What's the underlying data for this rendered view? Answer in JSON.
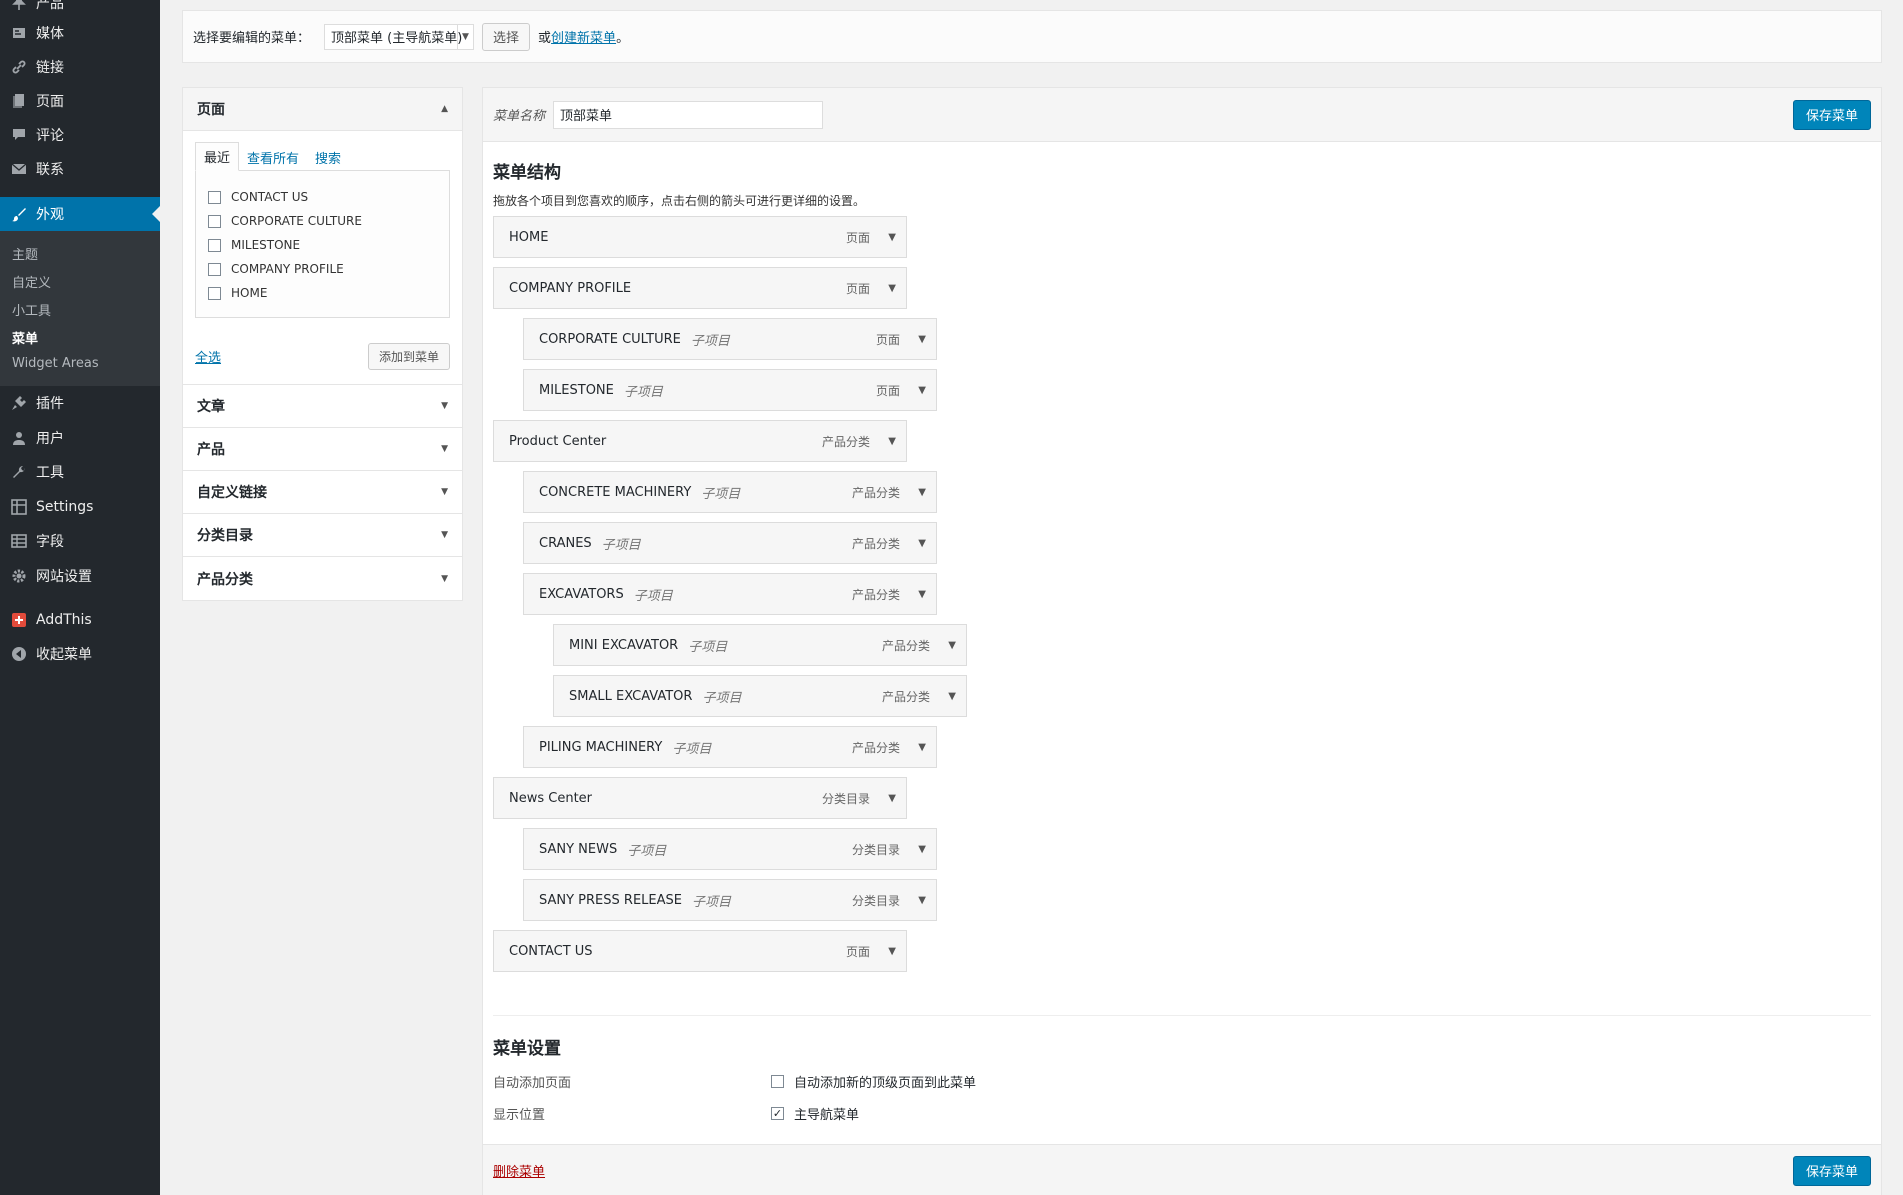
{
  "sidebar": {
    "items": [
      {
        "label": "产品",
        "icon": "pin-icon"
      },
      {
        "label": "媒体",
        "icon": "media-icon"
      },
      {
        "label": "链接",
        "icon": "link-icon"
      },
      {
        "label": "页面",
        "icon": "page-icon"
      },
      {
        "label": "评论",
        "icon": "comment-icon"
      },
      {
        "label": "联系",
        "icon": "mail-icon"
      },
      {
        "label": "外观",
        "icon": "brush-icon"
      },
      {
        "label": "插件",
        "icon": "plugin-icon"
      },
      {
        "label": "用户",
        "icon": "user-icon"
      },
      {
        "label": "工具",
        "icon": "wrench-icon"
      },
      {
        "label": "Settings",
        "icon": "settings-grid-icon"
      },
      {
        "label": "字段",
        "icon": "fields-icon"
      },
      {
        "label": "网站设置",
        "icon": "gear-icon"
      },
      {
        "label": "AddThis",
        "icon": "addthis-icon"
      },
      {
        "label": "收起菜单",
        "icon": "collapse-icon"
      }
    ],
    "submenu": [
      "主题",
      "自定义",
      "小工具",
      "菜单",
      "Widget Areas"
    ]
  },
  "topbar": {
    "label": "选择要编辑的菜单：",
    "selected": "顶部菜单 (主导航菜单)",
    "select_button": "选择",
    "or": "或",
    "create_link": "创建新菜单",
    "period": "。"
  },
  "left": {
    "pages_title": "页面",
    "tabs": [
      "最近",
      "查看所有",
      "搜索"
    ],
    "pages": [
      "CONTACT US",
      "CORPORATE CULTURE",
      "MILESTONE",
      "COMPANY PROFILE",
      "HOME"
    ],
    "select_all": "全选",
    "add_button": "添加到菜单",
    "sections": [
      "文章",
      "产品",
      "自定义链接",
      "分类目录",
      "产品分类"
    ]
  },
  "right": {
    "name_label": "菜单名称",
    "name_value": "顶部菜单",
    "save_button": "保存菜单",
    "structure_title": "菜单结构",
    "structure_desc": "拖放各个项目到您喜欢的顺序，点击右侧的箭头可进行更详细的设置。",
    "sub_label": "子项目",
    "items": [
      {
        "title": "HOME",
        "type": "页面",
        "depth": 0,
        "sub": false
      },
      {
        "title": "COMPANY PROFILE",
        "type": "页面",
        "depth": 0,
        "sub": false
      },
      {
        "title": "CORPORATE CULTURE",
        "type": "页面",
        "depth": 1,
        "sub": true
      },
      {
        "title": "MILESTONE",
        "type": "页面",
        "depth": 1,
        "sub": true
      },
      {
        "title": "Product Center",
        "type": "产品分类",
        "depth": 0,
        "sub": false
      },
      {
        "title": "CONCRETE MACHINERY",
        "type": "产品分类",
        "depth": 1,
        "sub": true
      },
      {
        "title": "CRANES",
        "type": "产品分类",
        "depth": 1,
        "sub": true
      },
      {
        "title": "EXCAVATORS",
        "type": "产品分类",
        "depth": 1,
        "sub": true
      },
      {
        "title": "MINI EXCAVATOR",
        "type": "产品分类",
        "depth": 2,
        "sub": true
      },
      {
        "title": "SMALL EXCAVATOR",
        "type": "产品分类",
        "depth": 2,
        "sub": true
      },
      {
        "title": "PILING MACHINERY",
        "type": "产品分类",
        "depth": 1,
        "sub": true
      },
      {
        "title": "News Center",
        "type": "分类目录",
        "depth": 0,
        "sub": false
      },
      {
        "title": "SANY NEWS",
        "type": "分类目录",
        "depth": 1,
        "sub": true
      },
      {
        "title": "SANY PRESS RELEASE",
        "type": "分类目录",
        "depth": 1,
        "sub": true
      },
      {
        "title": "CONTACT US",
        "type": "页面",
        "depth": 0,
        "sub": false
      }
    ],
    "settings_title": "菜单设置",
    "auto_add_label": "自动添加页面",
    "auto_add_option": "自动添加新的顶级页面到此菜单",
    "auto_add_checked": false,
    "location_label": "显示位置",
    "location_option": "主导航菜单",
    "location_checked": true,
    "delete_link": "删除菜单"
  },
  "colors": {
    "accent": "#0073aa",
    "primary_button": "#0085ba",
    "sidebar_bg": "#23282d",
    "delete": "#a00"
  }
}
